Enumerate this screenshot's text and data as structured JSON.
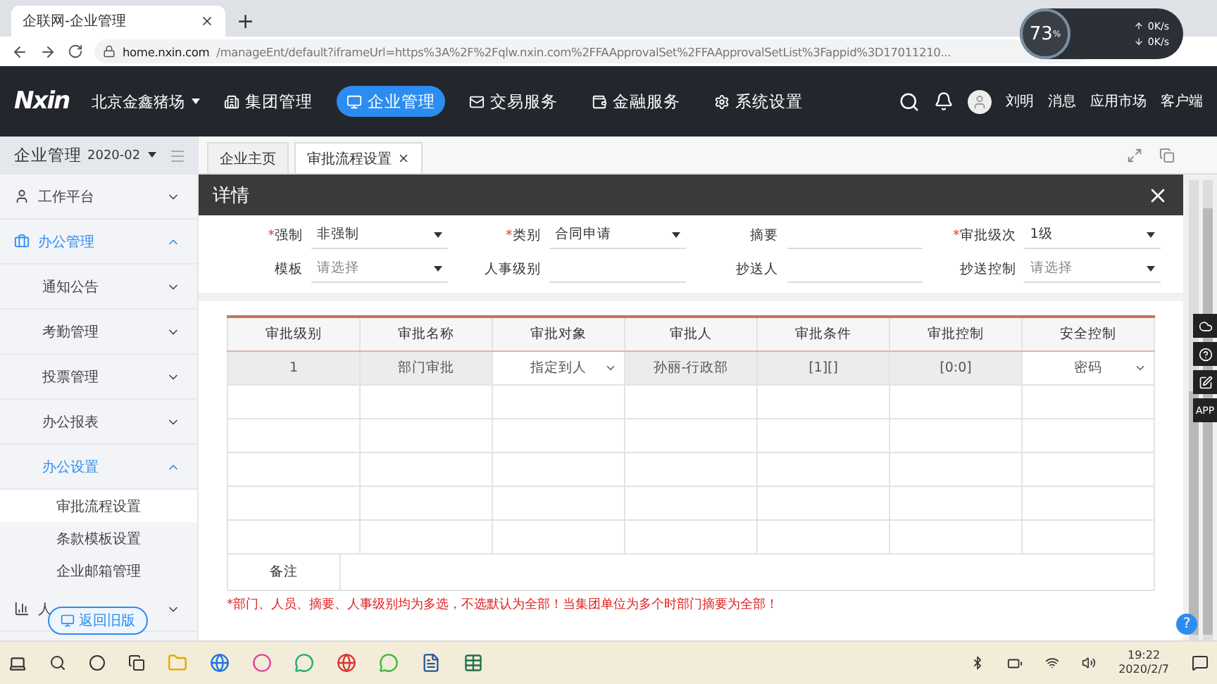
{
  "browser": {
    "tab_title": "企联网-企业管理",
    "new_tab": "+",
    "url_host": "home.nxin.com",
    "url_path": "/manageEnt/default?iframeUrl=https%3A%2F%2Fqlw.nxin.com%2FFAApprovalSet%2FFAApprovalSetList%3Fappid%3D17011210..."
  },
  "speed_widget": {
    "percent": "73",
    "percent_sign": "%",
    "up": "0",
    "down": "0",
    "unit_up": "K/s",
    "unit_down": "K/s"
  },
  "nav": {
    "logo": "Nxin",
    "org": "北京金鑫猪场",
    "items": [
      {
        "label": "集团管理",
        "selected": false
      },
      {
        "label": "企业管理",
        "selected": true
      },
      {
        "label": "交易服务",
        "selected": false
      },
      {
        "label": "金融服务",
        "selected": false
      },
      {
        "label": "系统设置",
        "selected": false
      }
    ],
    "user": "刘明",
    "links": [
      "消息",
      "应用市场",
      "客户端"
    ]
  },
  "sidebar": {
    "title": "企业管理",
    "period": "2020-02",
    "items": [
      {
        "label": "工作平台",
        "expanded": false
      },
      {
        "label": "办公管理",
        "expanded": true,
        "children": [
          {
            "label": "通知公告",
            "expanded": false
          },
          {
            "label": "考勤管理",
            "expanded": false
          },
          {
            "label": "投票管理",
            "expanded": false
          },
          {
            "label": "办公报表",
            "expanded": false
          },
          {
            "label": "办公设置",
            "expanded": true,
            "children": [
              {
                "label": "审批流程设置",
                "selected": true
              },
              {
                "label": "条款模板设置",
                "selected": false
              },
              {
                "label": "企业邮箱管理",
                "selected": false
              }
            ]
          }
        ]
      },
      {
        "label": "人",
        "expanded": false
      }
    ],
    "back_button": "返回旧版"
  },
  "tabs": [
    {
      "label": "企业主页",
      "selected": false
    },
    {
      "label": "审批流程设置",
      "selected": true
    }
  ],
  "dialog": {
    "title": "详情",
    "form": [
      {
        "label": "强制",
        "required_mark": "*",
        "kind": "select",
        "value": "非强制"
      },
      {
        "label": "类别",
        "required_mark": "*",
        "kind": "select",
        "value": "合同申请"
      },
      {
        "label": "摘要",
        "kind": "text"
      },
      {
        "label": "审批级次",
        "required_mark": "*",
        "kind": "select",
        "value": "1级"
      },
      {
        "label": "模板",
        "kind": "select",
        "placeholder": "请选择"
      },
      {
        "label": "人事级别",
        "kind": "text"
      },
      {
        "label": "抄送人",
        "kind": "text"
      },
      {
        "label": "抄送控制",
        "kind": "select",
        "placeholder": "请选择"
      }
    ],
    "table": {
      "columns": [
        "审批级别",
        "审批名称",
        "审批对象",
        "审批人",
        "审批条件",
        "审批控制",
        "安全控制"
      ],
      "rows": [
        [
          {
            "text": "1",
            "kind": "readonly"
          },
          {
            "text": "部门审批",
            "kind": "readonly"
          },
          {
            "text": "指定到人",
            "kind": "select"
          },
          {
            "text": "孙丽-行政部",
            "kind": "readonly"
          },
          {
            "text": "[1][]",
            "kind": "readonly"
          },
          {
            "text": "[0:0]",
            "kind": "readonly"
          },
          {
            "text": "密码",
            "kind": "select"
          }
        ]
      ]
    },
    "remark_label": "备注",
    "note": "*部门、人员、摘要、人事级别均为多选，不选默认为全部！当集团单位为多个时部门摘要为全部！"
  },
  "float_tools": {
    "app_label": "APP"
  },
  "help_label": "?",
  "taskbar": {
    "time": "19:22",
    "date": "2020/2/7"
  }
}
